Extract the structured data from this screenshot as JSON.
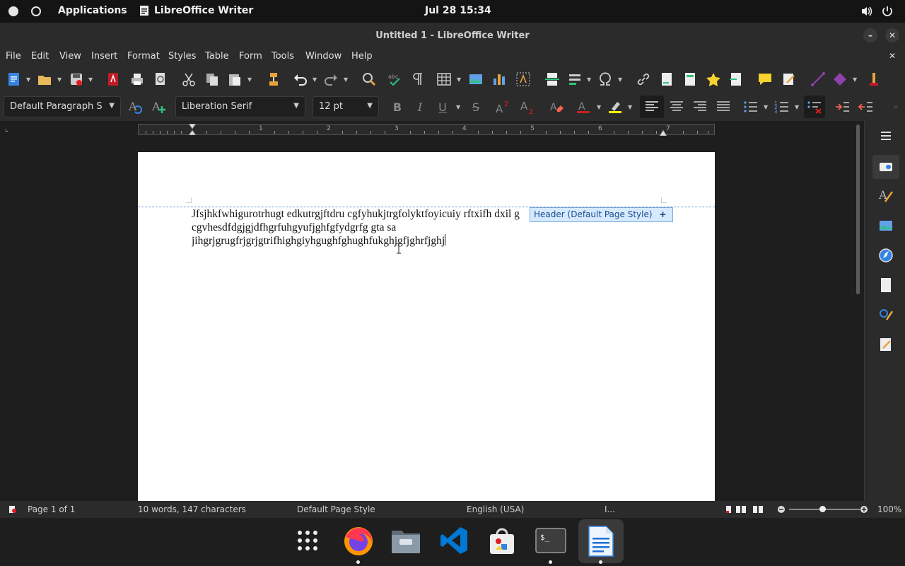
{
  "topbar": {
    "activities_label": "Applications",
    "app_label": "LibreOffice Writer",
    "clock": "Jul 28  15:34"
  },
  "window": {
    "title": "Untitled 1 - LibreOffice Writer",
    "minimize_symbol": "–",
    "close_symbol": "✕"
  },
  "menu": {
    "items": [
      "File",
      "Edit",
      "View",
      "Insert",
      "Format",
      "Styles",
      "Table",
      "Form",
      "Tools",
      "Window",
      "Help"
    ],
    "close_doc_symbol": "✕"
  },
  "formatting": {
    "paragraph_style": "Default Paragraph S",
    "font_name": "Liberation Serif",
    "font_size": "12 pt"
  },
  "document": {
    "lines": [
      "Jfsjhkfwhigurotrhugt edkutrgjftdru cgfyhukjtrgfolyktfoyicuiy rftxifh dxil g",
      "cgvhesdfdgjgjdfhgrfuhgyufjghfgfydgrfg gta sa",
      "jihgrjgrugfrjgrjgtrifhighgiyhgughfghughfukghjgfjghrfjghj"
    ],
    "header_tag": "Header (Default Page Style)",
    "header_plus": "+"
  },
  "ruler": {
    "numbers": [
      "1",
      "2",
      "3",
      "4",
      "5",
      "6",
      "7"
    ]
  },
  "status": {
    "page": "Page 1 of 1",
    "counts": "10 words, 147 characters",
    "page_style": "Default Page Style",
    "language": "English (USA)",
    "insert_mode": "I...",
    "zoom": "100%"
  },
  "colors": {
    "font_color_bar": "#c9211e",
    "highlight_bar": "#ffff00",
    "accent": "#3584e4"
  }
}
